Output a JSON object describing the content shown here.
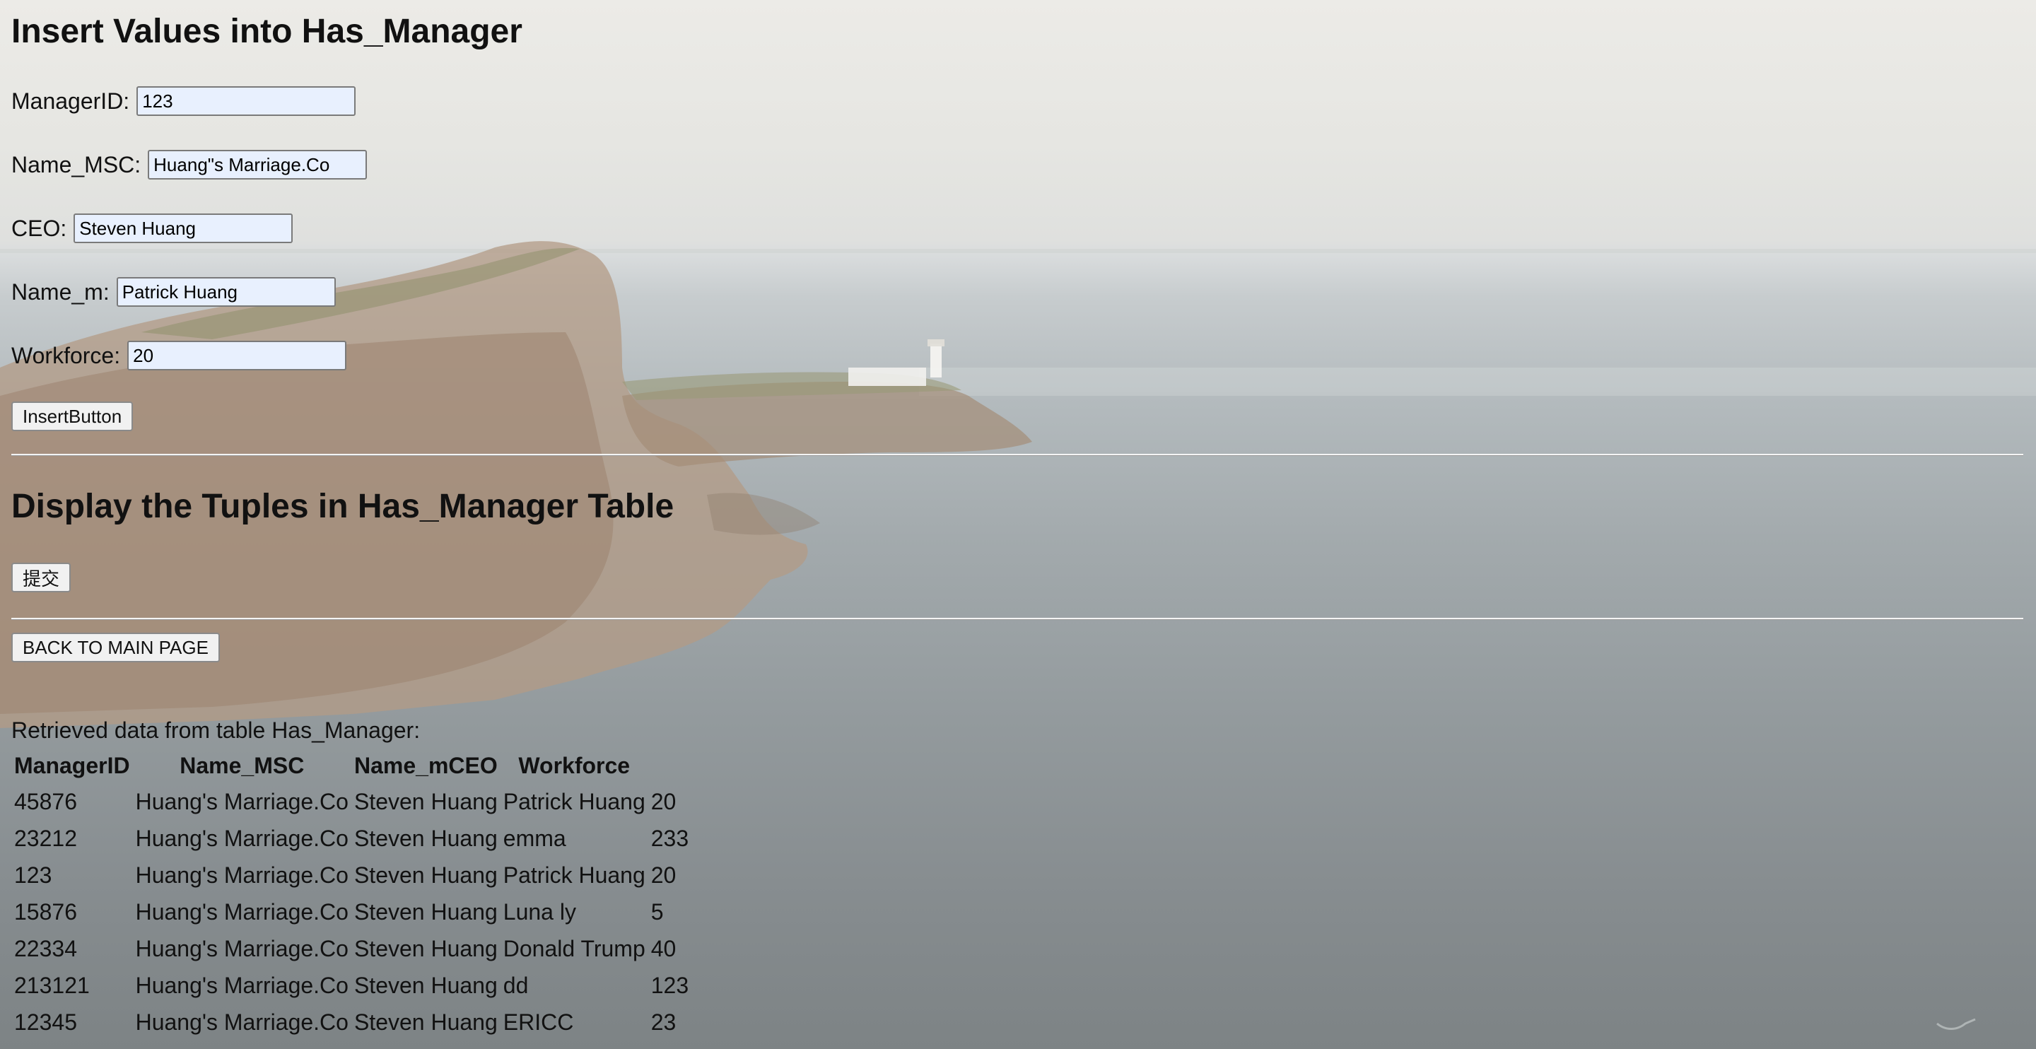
{
  "insert_section": {
    "title": "Insert Values into Has_Manager",
    "fields": [
      {
        "label": "ManagerID:",
        "value": "123"
      },
      {
        "label": "Name_MSC:",
        "value": "Huang\"s Marriage.Co"
      },
      {
        "label": "CEO:",
        "value": "Steven Huang"
      },
      {
        "label": "Name_m:",
        "value": "Patrick Huang"
      },
      {
        "label": "Workforce:",
        "value": "20"
      }
    ],
    "insert_button": "InsertButton"
  },
  "display_section": {
    "title": "Display the Tuples in Has_Manager Table",
    "submit_button": "提交",
    "back_button": "BACK TO MAIN PAGE"
  },
  "results": {
    "caption": "Retrieved data from table Has_Manager:",
    "headers": [
      "ManagerID",
      "Name_MSC",
      "Name_mCEO",
      "Workforce"
    ],
    "rows": [
      [
        "45876",
        "Huang's Marriage.Co",
        "Steven Huang",
        "Patrick Huang",
        "20"
      ],
      [
        "23212",
        "Huang's Marriage.Co",
        "Steven Huang",
        "emma",
        "233"
      ],
      [
        "123",
        "Huang's Marriage.Co",
        "Steven Huang",
        "Patrick Huang",
        "20"
      ],
      [
        "15876",
        "Huang's Marriage.Co",
        "Steven Huang",
        "Luna ly",
        "5"
      ],
      [
        "22334",
        "Huang's Marriage.Co",
        "Steven Huang",
        "Donald Trump",
        "40"
      ],
      [
        "213121",
        "Huang's Marriage.Co",
        "Steven Huang",
        "dd",
        "123"
      ],
      [
        "12345",
        "Huang's Marriage.Co",
        "Steven Huang",
        "ERICC",
        "23"
      ]
    ]
  },
  "background": {
    "description_icon": "coastal-cliff-lighthouse-background",
    "sky_color": "#ecebe7",
    "sea_color": "#9aa2a5",
    "cliff_color": "#b79a7e"
  }
}
